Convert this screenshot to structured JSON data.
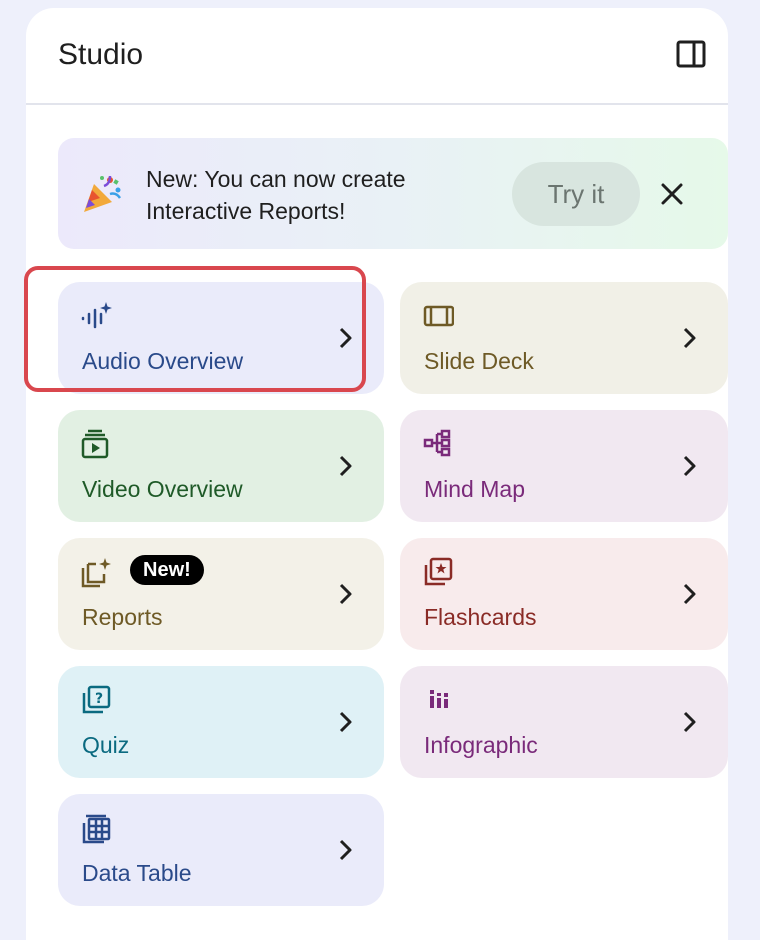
{
  "header": {
    "title": "Studio"
  },
  "banner": {
    "text": "New: You can now create Interactive Reports!",
    "try_label": "Try it"
  },
  "tiles": [
    {
      "label": "Audio Overview",
      "icon": "audio-waveform-sparkle-icon",
      "bg": "#eaebfa",
      "fg": "#2a4a8a",
      "selected": true
    },
    {
      "label": "Slide Deck",
      "icon": "slides-icon",
      "bg": "#f1f0e7",
      "fg": "#6e5a26"
    },
    {
      "label": "Video Overview",
      "icon": "video-icon",
      "bg": "#e2f0e3",
      "fg": "#1f5a28"
    },
    {
      "label": "Mind Map",
      "icon": "mind-map-icon",
      "bg": "#f1e8f1",
      "fg": "#7a2a7a"
    },
    {
      "label": "Reports",
      "icon": "reports-sparkle-icon",
      "bg": "#f3f1e8",
      "fg": "#6e5a26",
      "badge": "New!"
    },
    {
      "label": "Flashcards",
      "icon": "flashcards-icon",
      "bg": "#f8ebec",
      "fg": "#8a2b26"
    },
    {
      "label": "Quiz",
      "icon": "quiz-icon",
      "bg": "#dff1f6",
      "fg": "#0a6a80"
    },
    {
      "label": "Infographic",
      "icon": "infographic-icon",
      "bg": "#f1e8f1",
      "fg": "#7a2a7a"
    },
    {
      "label": "Data Table",
      "icon": "table-icon",
      "bg": "#eaebfa",
      "fg": "#2a4a8a"
    }
  ]
}
